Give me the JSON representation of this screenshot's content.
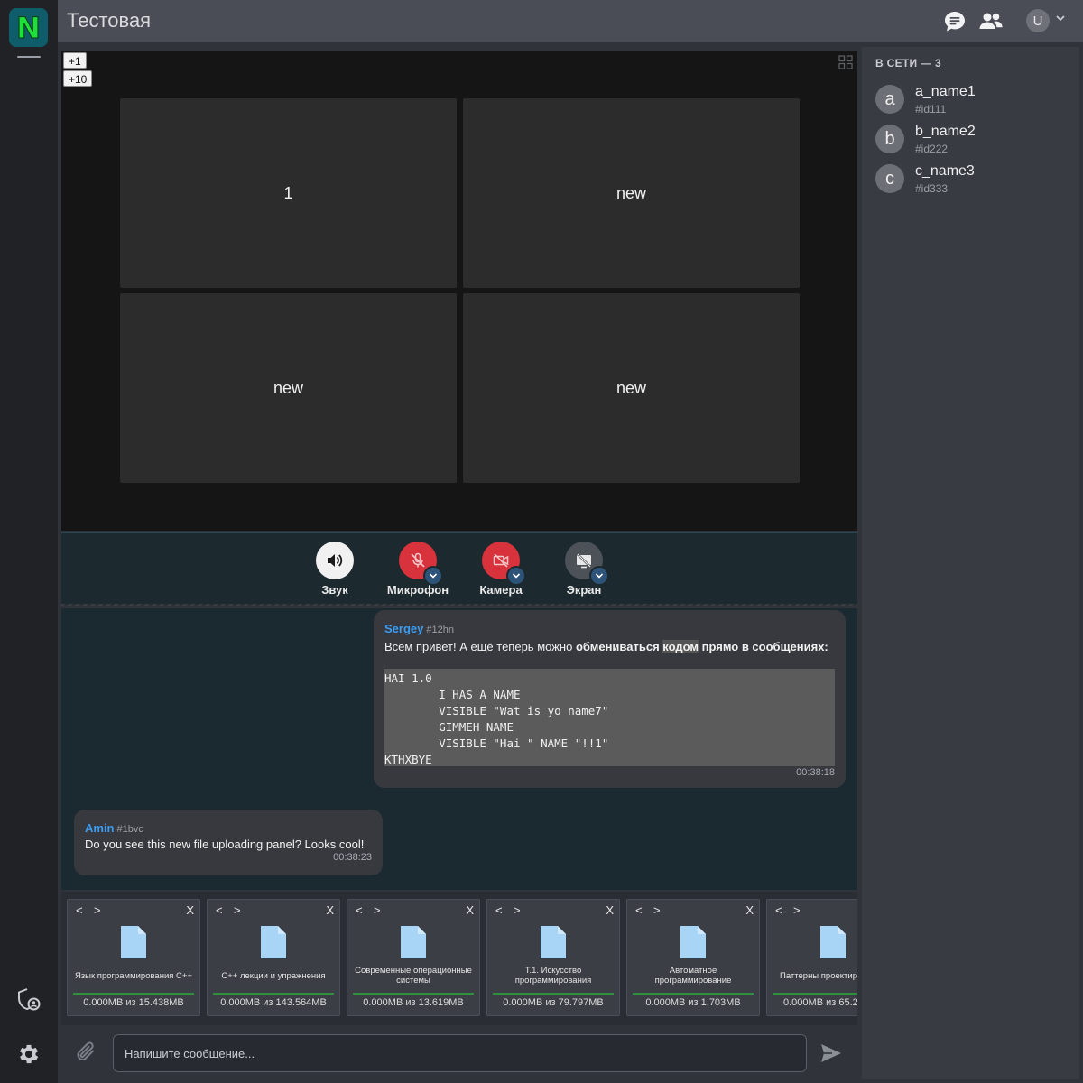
{
  "app": {
    "logo_letter": "N"
  },
  "header": {
    "title": "Тестовая",
    "user_initial": "U"
  },
  "video": {
    "zoom_buttons": [
      "+1",
      "+10"
    ],
    "tiles": [
      "1",
      "new",
      "new",
      "new"
    ]
  },
  "controls": [
    {
      "label": "Звук",
      "icon": "speaker-icon",
      "state": "on"
    },
    {
      "label": "Микрофон",
      "icon": "mic-off-icon",
      "state": "off"
    },
    {
      "label": "Камера",
      "icon": "camera-off-icon",
      "state": "off"
    },
    {
      "label": "Экран",
      "icon": "screen-off-icon",
      "state": "inactive"
    }
  ],
  "chat": {
    "messages": [
      {
        "author": "Sergey",
        "id": "#12hn",
        "text_before": "Всем привет! А ещё теперь можно ",
        "text_bold1": "обмениваться ",
        "text_hl": "кодом",
        "text_bold2": " прямо в сообщениях:",
        "code": "HAI 1.0\n        I HAS A NAME\n        VISIBLE \"Wat is yo name7\"\n        GIMMEH NAME\n        VISIBLE \"Hai \" NAME \"!!1\"\nKTHXBYE",
        "time": "00:38:18"
      },
      {
        "author": "Amin",
        "id": "#1bvc",
        "text": "Do you see this new file uploading panel? Looks cool!",
        "time": "00:38:23"
      }
    ]
  },
  "files": [
    {
      "name": "Язык программирования С++",
      "size": "0.000MB из 15.438MB",
      "progress": 1.0
    },
    {
      "name": "С++ лекции и упражнения",
      "size": "0.000MB из 143.564MB",
      "progress": 1.0
    },
    {
      "name": "Современные операционные системы",
      "size": "0.000MB из 13.619MB",
      "progress": 1.0
    },
    {
      "name": "Т.1. Искусство программирования",
      "size": "0.000MB из 79.797MB",
      "progress": 1.0
    },
    {
      "name": "Автоматное программирование",
      "size": "0.000MB из 1.703MB",
      "progress": 1.0
    },
    {
      "name": "Паттерны проектир",
      "size": "0.000MB из 65.2",
      "progress": 1.0
    }
  ],
  "file_card": {
    "prev": "<",
    "next": ">",
    "close": "X"
  },
  "composer": {
    "placeholder": "Напишите сообщение..."
  },
  "members": {
    "title": "В СЕТИ — 3",
    "list": [
      {
        "initial": "a",
        "name": "a_name1",
        "id": "#id111"
      },
      {
        "initial": "b",
        "name": "b_name2",
        "id": "#id222"
      },
      {
        "initial": "c",
        "name": "c_name3",
        "id": "#id333"
      }
    ]
  },
  "colors": {
    "accent": "#3d9cf0",
    "danger": "#d8323c",
    "progress": "#2f8f3c",
    "logo_bg": "#0f5d6a",
    "logo_fg": "#1fe03a"
  }
}
